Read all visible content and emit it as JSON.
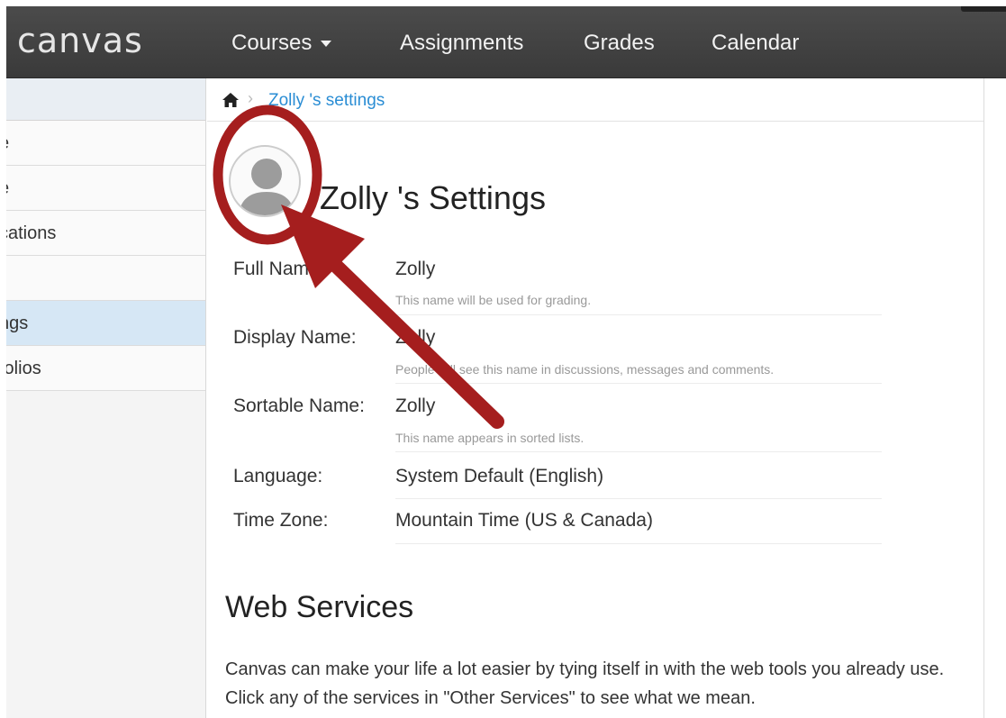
{
  "app": {
    "logo": "canvas",
    "nav": [
      {
        "label": "Courses"
      },
      {
        "label": "Assignments"
      },
      {
        "label": "Grades"
      },
      {
        "label": "Calendar"
      }
    ]
  },
  "sidebar": {
    "items": [
      {
        "label": "e"
      },
      {
        "label": "e"
      },
      {
        "label": "cations"
      },
      {
        "label": ""
      },
      {
        "label": "ngs"
      },
      {
        "label": "folios"
      }
    ]
  },
  "breadcrumb": {
    "current": "Zolly 's settings"
  },
  "profile": {
    "title": "Zolly 's Settings",
    "fields": [
      {
        "label": "Full Name:",
        "value": "Zolly",
        "hint": "This name will be used for grading."
      },
      {
        "label": "Display Name:",
        "value": "Zolly",
        "hint": "People will see this name in discussions, messages and comments."
      },
      {
        "label": "Sortable Name:",
        "value": "Zolly",
        "hint": "This name appears in sorted lists."
      },
      {
        "label": "Language:",
        "value": "System Default (English)",
        "hint": ""
      },
      {
        "label": "Time Zone:",
        "value": "Mountain Time (US & Canada)",
        "hint": ""
      }
    ]
  },
  "web_services": {
    "title": "Web Services",
    "description": "Canvas can make your life a lot easier by tying itself in with the web tools you already use. Click any of the services in \"Other Services\" to see what we mean."
  },
  "colors": {
    "nav_bg": "#3f3f3f",
    "link": "#2a8dd4",
    "active_item": "#d6e7f5",
    "annotation": "#a51e1e"
  },
  "icons": {
    "home": "home-icon",
    "caret": "chevron-down-icon",
    "avatar": "default-avatar-icon"
  }
}
